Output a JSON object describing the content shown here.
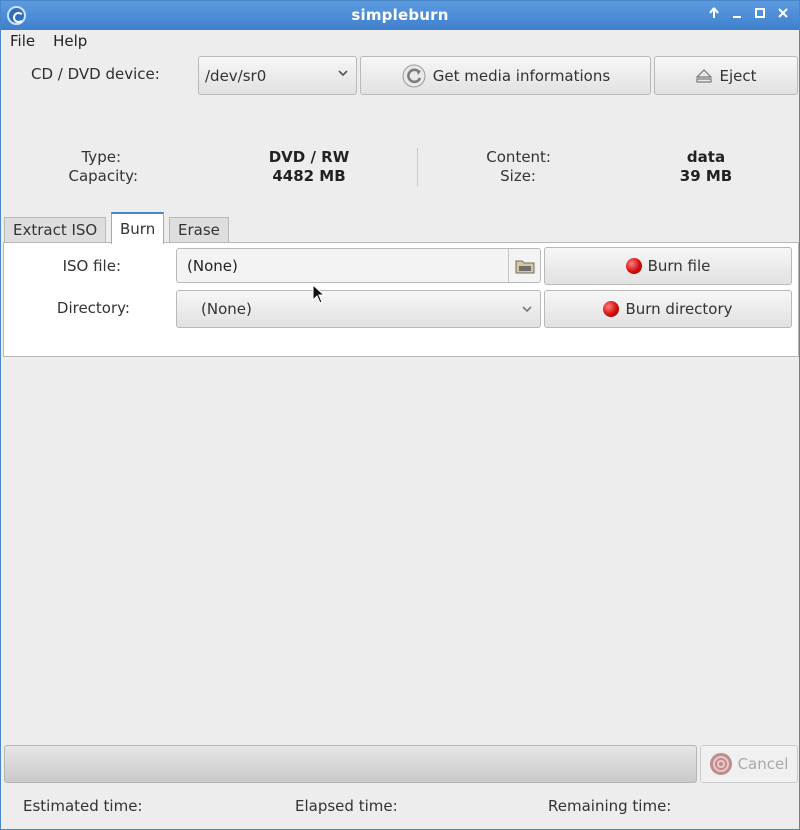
{
  "window": {
    "title": "simpleburn"
  },
  "menu": [
    "File",
    "Help"
  ],
  "device": {
    "label": "CD / DVD device:",
    "selected": "/dev/sr0",
    "get_media_label": "Get media informations",
    "eject_label": "Eject"
  },
  "media": {
    "type_label": "Type:",
    "type_value": "DVD / RW",
    "capacity_label": "Capacity:",
    "capacity_value": "4482 MB",
    "content_label": "Content:",
    "content_value": "data",
    "size_label": "Size:",
    "size_value": "39 MB"
  },
  "tabs": [
    {
      "label": "Extract ISO",
      "active": false
    },
    {
      "label": "Burn",
      "active": true
    },
    {
      "label": "Erase",
      "active": false
    }
  ],
  "burn": {
    "iso_label": "ISO file:",
    "iso_value": "(None)",
    "directory_label": "Directory:",
    "directory_value": "(None)",
    "burn_file_label": "Burn file",
    "burn_directory_label": "Burn directory"
  },
  "bottom": {
    "cancel_label": "Cancel",
    "estimated_label": "Estimated time:",
    "elapsed_label": "Elapsed time:",
    "remaining_label": "Remaining time:",
    "progress": 0
  },
  "icons": {
    "app": "disc-icon",
    "refresh": "refresh-icon",
    "eject": "eject-icon",
    "folder": "folder-icon",
    "burn": "red-dot-icon",
    "cancel": "stop-icon"
  },
  "colors": {
    "titlebar": "#4a87c9",
    "burn_dot": "#d20d0d"
  }
}
